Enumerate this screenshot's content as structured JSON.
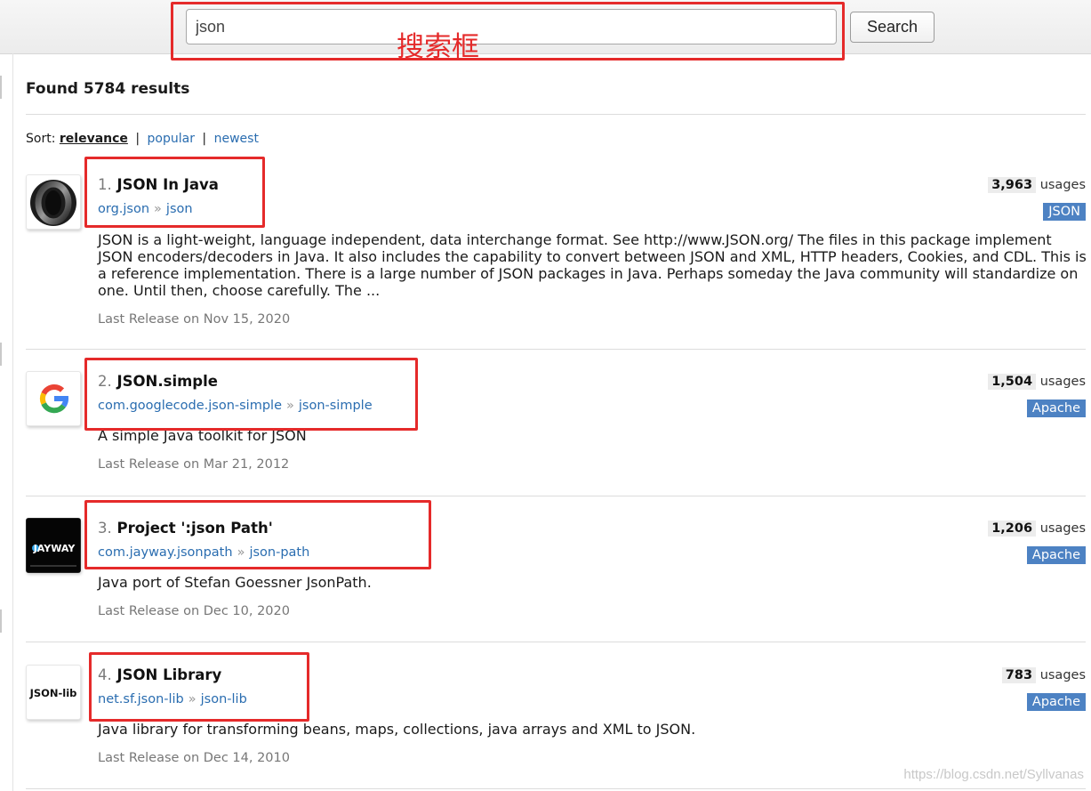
{
  "search": {
    "query": "json",
    "button_label": "Search"
  },
  "annotation_label": "搜索框",
  "summary": {
    "found_text": "Found 5784 results"
  },
  "sort": {
    "label": "Sort:",
    "options": [
      "relevance",
      "popular",
      "newest"
    ],
    "separator": "|"
  },
  "results": [
    {
      "index": "1.",
      "title": "JSON In Java",
      "group": "org.json",
      "artifact": "json",
      "arrow": "»",
      "usage_count": "3,963",
      "usage_suffix": "usages",
      "license": "JSON",
      "description": "JSON is a light-weight, language independent, data interchange format. See http://www.JSON.org/ The files in this package implement JSON encoders/decoders in Java. It also includes the capability to convert between JSON and XML, HTTP headers, Cookies, and CDL. This is a reference implementation. There is a large number of JSON packages in Java. Perhaps someday the Java community will standardize on one. Until then, choose carefully. The ...",
      "release": "Last Release on Nov 15, 2020",
      "logo_icon": "json-org-ring-icon"
    },
    {
      "index": "2.",
      "title": "JSON.simple",
      "group": "com.googlecode.json-simple",
      "artifact": "json-simple",
      "arrow": "»",
      "usage_count": "1,504",
      "usage_suffix": "usages",
      "license": "Apache",
      "description": "A simple Java toolkit for JSON",
      "release": "Last Release on Mar 21, 2012",
      "logo_icon": "google-g-icon"
    },
    {
      "index": "3.",
      "title": "Project ':json Path'",
      "group": "com.jayway.jsonpath",
      "artifact": "json-path",
      "arrow": "»",
      "usage_count": "1,206",
      "usage_suffix": "usages",
      "license": "Apache",
      "description": "Java port of Stefan Goessner JsonPath.",
      "release": "Last Release on Dec 10, 2020",
      "logo_icon": "jayway-logo-icon"
    },
    {
      "index": "4.",
      "title": "JSON Library",
      "group": "net.sf.json-lib",
      "artifact": "json-lib",
      "arrow": "»",
      "usage_count": "783",
      "usage_suffix": "usages",
      "license": "Apache",
      "description": "Java library for transforming beans, maps, collections, java arrays and XML to JSON.",
      "release": "Last Release on Dec 14, 2010",
      "logo_icon": "json-lib-logo-icon"
    }
  ],
  "logos": {
    "jayway_text": "JAYWAY",
    "jsonlib_text": "JSON-lib"
  },
  "watermark": "https://blog.csdn.net/Syllvanas",
  "colors": {
    "link": "#2a6db0",
    "license_badge": "#4d82c3",
    "annotation": "#e52a2a"
  }
}
